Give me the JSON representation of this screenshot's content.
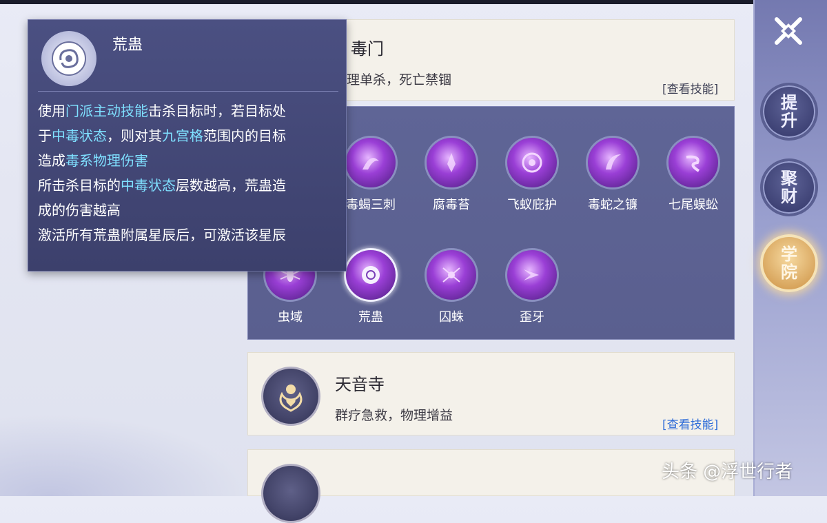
{
  "sects": [
    {
      "title": "毒门",
      "desc": "物理单杀，死亡禁锢",
      "link": "[查看技能]"
    },
    {
      "title": "天音寺",
      "desc": "群疗急救，物理增益",
      "link": "[查看技能]"
    }
  ],
  "skills_row1": [
    "毒蝎三刺",
    "腐毒苔",
    "飞蚁庇护",
    "毒蛇之镰",
    "七尾蜈蚣"
  ],
  "skills_row2": [
    "虫域",
    "荒蛊",
    "囚蛛",
    "歪牙"
  ],
  "tooltip": {
    "title": "荒蛊",
    "l1a": "使用",
    "l1b": "门派主动技能",
    "l1c": "击杀目标时，若目标处",
    "l2a": "于",
    "l2b": "中毒状态",
    "l2c": "，则对其",
    "l2d": "九宫格",
    "l2e": "范围内的目标",
    "l3a": "造成",
    "l3b": "毒系物理伤害",
    "l4a": "所击杀目标的",
    "l4b": "中毒状态",
    "l4c": "层数越高，荒蛊造",
    "l5": "成的伤害越高",
    "l6": "激活所有荒蛊附属星辰后，可激活该星辰"
  },
  "rail": {
    "b1": "提升",
    "b2": "聚财",
    "b3": "学院"
  },
  "watermark": "头条 @浮世行者",
  "colors": {
    "highlight": "#7fe0ff",
    "link_blue": "#2d6bd8",
    "panel": "#5f6596"
  }
}
